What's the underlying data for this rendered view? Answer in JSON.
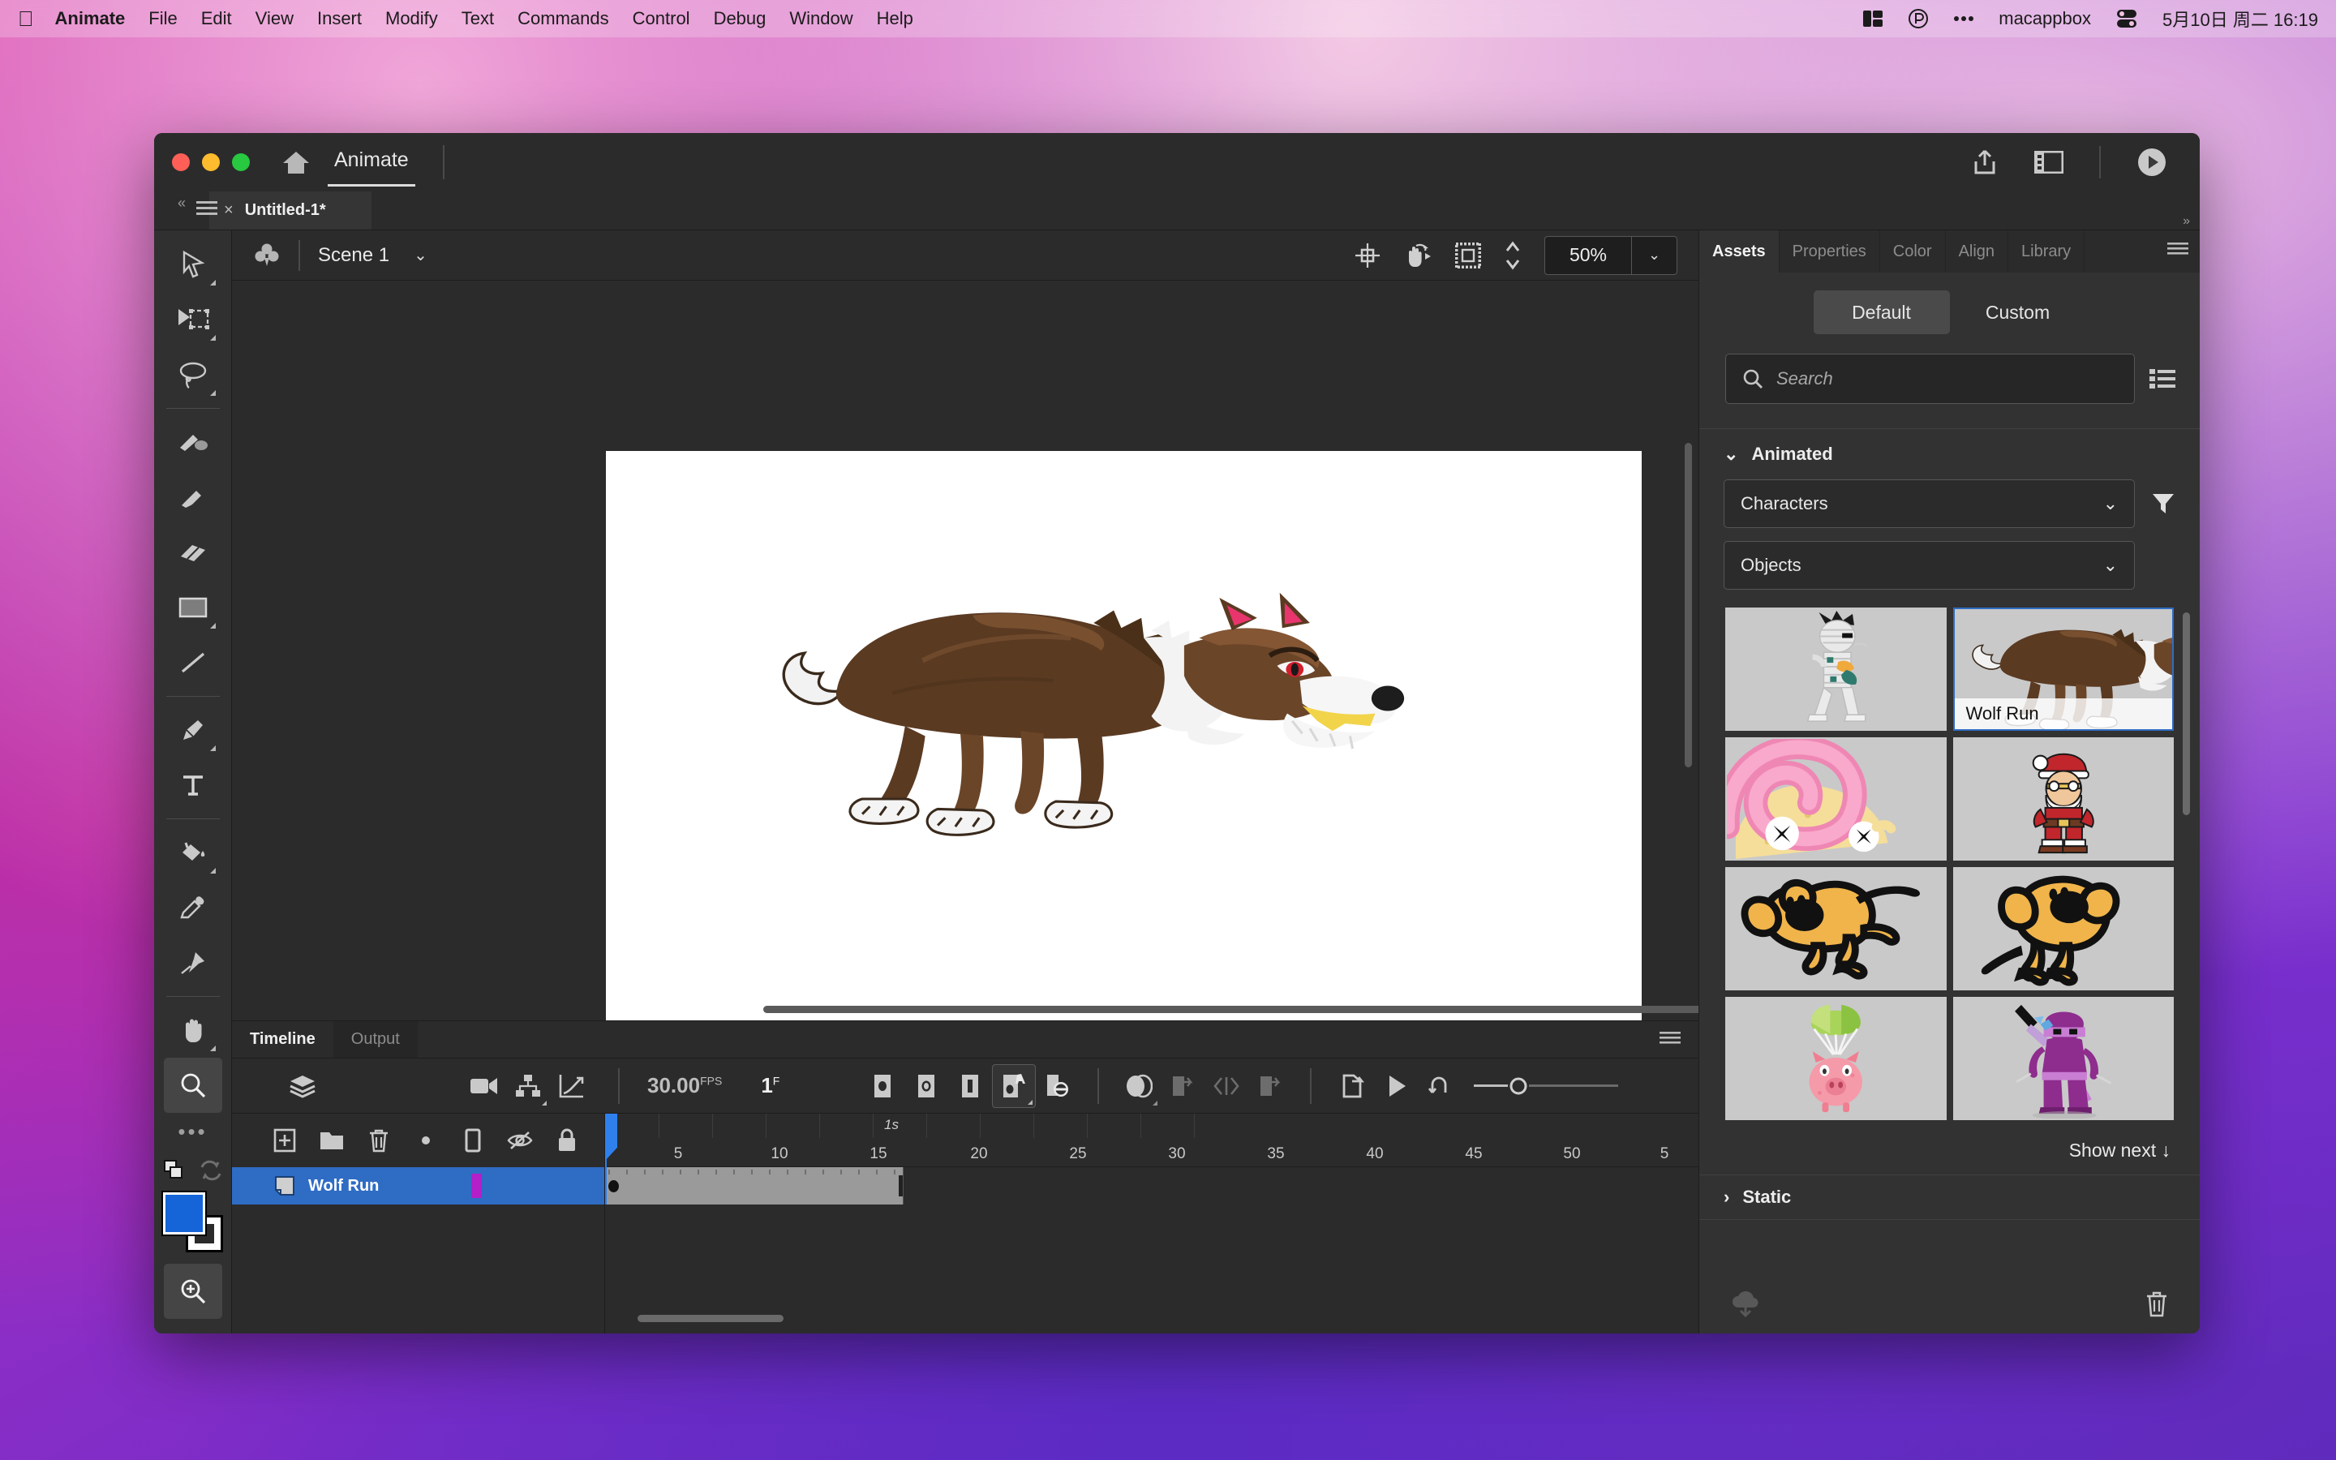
{
  "menubar": {
    "apple_icon": "apple-logo-icon",
    "items": [
      {
        "label": "Animate",
        "bold": true
      },
      {
        "label": "File",
        "bold": false
      },
      {
        "label": "Edit",
        "bold": false
      },
      {
        "label": "View",
        "bold": false
      },
      {
        "label": "Insert",
        "bold": false
      },
      {
        "label": "Modify",
        "bold": false
      },
      {
        "label": "Text",
        "bold": false
      },
      {
        "label": "Commands",
        "bold": false
      },
      {
        "label": "Control",
        "bold": false
      },
      {
        "label": "Debug",
        "bold": false
      },
      {
        "label": "Window",
        "bold": false
      },
      {
        "label": "Help",
        "bold": false
      }
    ],
    "status": {
      "control_center_icon": "control-center-icon",
      "shield_icon": "shield-p-icon",
      "more_icon": "ellipsis-icon",
      "user": "macappbox",
      "battery_icon": "battery-icon",
      "datetime": "5月10日 周二  16:19"
    }
  },
  "window": {
    "traffic": {
      "close": "close-window-button",
      "minimize": "minimize-window-button",
      "zoom": "zoom-window-button"
    },
    "home_icon": "home-icon",
    "app_tab": "Animate",
    "actions": {
      "share_icon": "share-icon",
      "workspace_icon": "workspace-layout-icon",
      "play_icon": "play-preview-icon"
    },
    "document_tab": {
      "label": "Untitled-1*",
      "close": "×"
    },
    "collapse_icon": "«",
    "panel_menu_icon": "panel-menu-icon"
  },
  "toolbar": {
    "tools": [
      {
        "name": "selection-tool",
        "icon": "arrow-cursor",
        "active": false,
        "flyout": true
      },
      {
        "name": "free-transform-tool",
        "icon": "free-transform",
        "active": false,
        "flyout": true
      },
      {
        "name": "lasso-tool",
        "icon": "lasso",
        "active": false,
        "flyout": true
      },
      {
        "name": "brush-tool",
        "icon": "paint-brush",
        "active": false,
        "flyout": false
      },
      {
        "name": "paintbrush-tool",
        "icon": "brush",
        "active": false,
        "flyout": false
      },
      {
        "name": "eraser-tool",
        "icon": "eraser",
        "active": false,
        "flyout": false
      },
      {
        "name": "rectangle-tool",
        "icon": "rectangle",
        "active": false,
        "flyout": true
      },
      {
        "name": "line-tool",
        "icon": "line",
        "active": false,
        "flyout": false
      },
      {
        "name": "pen-tool",
        "icon": "pen",
        "active": false,
        "flyout": true
      },
      {
        "name": "text-tool",
        "icon": "text-T",
        "active": false,
        "flyout": false
      },
      {
        "name": "paint-bucket-tool",
        "icon": "paint-bucket",
        "active": false,
        "flyout": true
      },
      {
        "name": "eyedropper-tool",
        "icon": "eyedropper",
        "active": false,
        "flyout": false
      },
      {
        "name": "bone-tool",
        "icon": "pin",
        "active": false,
        "flyout": false
      },
      {
        "name": "hand-tool",
        "icon": "hand",
        "active": false,
        "flyout": true
      },
      {
        "name": "zoom-tool",
        "icon": "magnifier",
        "active": true,
        "flyout": false
      }
    ],
    "more_label": "•••",
    "swatch": {
      "fill_color": "#1565d8",
      "stroke_color": "#ffffff"
    },
    "zoom_in_icon": "zoom-in-icon"
  },
  "stage": {
    "scene_icon": "scene-club-icon",
    "scene_name": "Scene 1",
    "scene_chevron": "⌄",
    "center_icon": "center-stage-icon",
    "rotate_icon": "rotate-hand-icon",
    "clip_icon": "clip-content-icon",
    "zoom_value": "50%",
    "zoom_chevron": "⌄"
  },
  "timeline": {
    "tabs": [
      {
        "label": "Timeline",
        "active": true
      },
      {
        "label": "Output",
        "active": false
      }
    ],
    "menu_icon": "timeline-menu-icon",
    "layers_icon": "layer-stack-icon",
    "tools_left": [
      {
        "name": "camera-tool-icon"
      },
      {
        "name": "layer-parenting-icon"
      },
      {
        "name": "graph-editor-icon"
      }
    ],
    "fps_value": "30.00",
    "fps_suffix": "FPS",
    "frame_value": "1",
    "frame_suffix": "F",
    "tools_mid": [
      {
        "name": "insert-keyframe-icon",
        "active": false
      },
      {
        "name": "insert-blank-keyframe-icon",
        "active": false
      },
      {
        "name": "insert-frame-icon",
        "active": false
      },
      {
        "name": "create-classic-tween-icon",
        "active": true
      },
      {
        "name": "remove-tween-icon",
        "active": false
      },
      {
        "name": "onion-skin-icon",
        "active": false
      },
      {
        "name": "onion-skin-outlines-icon",
        "active": false
      },
      {
        "name": "edit-multiple-frames-icon",
        "active": false
      },
      {
        "name": "modify-onion-markers-icon",
        "active": false
      }
    ],
    "tools_right": [
      {
        "name": "export-icon"
      },
      {
        "name": "play-icon"
      },
      {
        "name": "loop-icon"
      }
    ],
    "zoom_slider_label": "frame-zoom-slider",
    "layer_tools": [
      {
        "name": "new-layer-icon"
      },
      {
        "name": "new-folder-icon"
      },
      {
        "name": "delete-layer-icon"
      },
      {
        "name": "keyframe-dot-icon"
      },
      {
        "name": "outline-icon"
      },
      {
        "name": "hide-layer-icon"
      },
      {
        "name": "lock-layer-icon"
      }
    ],
    "layers": [
      {
        "name": "Wolf Run",
        "selected": true
      }
    ],
    "ruler": {
      "second_label": "1s",
      "ticks": [
        5,
        10,
        15,
        20,
        25,
        30,
        35,
        40,
        45,
        50,
        5
      ]
    },
    "playhead_frame": 1,
    "frame_span_frames": 29
  },
  "right_panel": {
    "tabs": [
      {
        "label": "Assets",
        "active": true
      },
      {
        "label": "Properties",
        "active": false
      },
      {
        "label": "Color",
        "active": false
      },
      {
        "label": "Align",
        "active": false
      },
      {
        "label": "Library",
        "active": false
      }
    ],
    "expand_icon": "»",
    "menu_icon": "panel-options-icon",
    "segments": [
      {
        "label": "Default",
        "active": true
      },
      {
        "label": "Custom",
        "active": false
      }
    ],
    "search": {
      "placeholder": "Search",
      "value": "",
      "icon": "search-icon"
    },
    "list_view_icon": "list-view-icon",
    "sections": [
      {
        "title": "Animated",
        "expanded": true,
        "chevron": "⌄",
        "filters": [
          {
            "name": "category-dropdown",
            "value": "Characters",
            "chevron": "⌄"
          },
          {
            "name": "type-dropdown",
            "value": "Objects",
            "chevron": "⌄"
          }
        ],
        "filter_icon": "filter-funnel-icon",
        "assets": [
          {
            "name": "Mummy Walk",
            "caption": "",
            "selected": false,
            "art": "mummy"
          },
          {
            "name": "Wolf Run",
            "caption": "Wolf Run",
            "selected": true,
            "art": "wolf"
          },
          {
            "name": "Snail",
            "caption": "",
            "selected": false,
            "art": "snail"
          },
          {
            "name": "Santa",
            "caption": "",
            "selected": false,
            "art": "santa"
          },
          {
            "name": "Dog Run",
            "caption": "",
            "selected": false,
            "art": "dogrun"
          },
          {
            "name": "Dog Sit",
            "caption": "",
            "selected": false,
            "art": "dogsit"
          },
          {
            "name": "Pig Parachute",
            "caption": "",
            "selected": false,
            "art": "pig"
          },
          {
            "name": "Ninja",
            "caption": "",
            "selected": false,
            "art": "ninja"
          }
        ],
        "show_next": "Show next ↓"
      },
      {
        "title": "Static",
        "expanded": false,
        "chevron": "›"
      }
    ],
    "footer": {
      "download_icon": "cloud-download-icon",
      "delete_icon": "trash-icon"
    }
  }
}
